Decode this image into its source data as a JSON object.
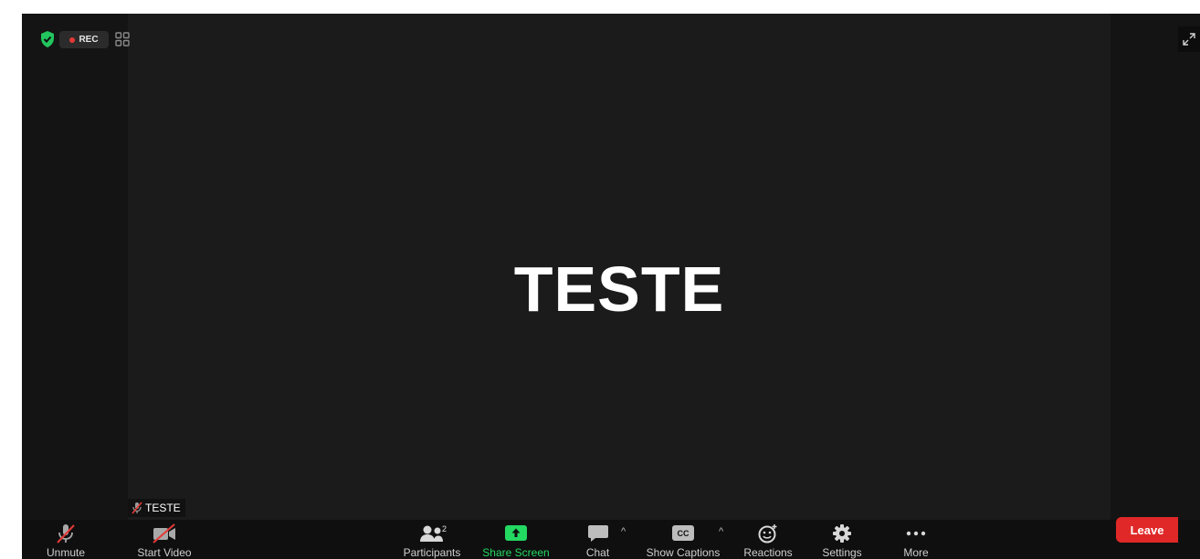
{
  "meeting": {
    "center_name": "TESTE",
    "name_tag": "TESTE",
    "rec_label": "REC"
  },
  "toolbar": {
    "unmute": "Unmute",
    "start_video": "Start Video",
    "participants": "Participants",
    "participants_count": "2",
    "share_screen": "Share Screen",
    "chat": "Chat",
    "show_captions": "Show Captions",
    "captions_icon_text": "CC",
    "reactions": "Reactions",
    "settings": "Settings",
    "more": "More",
    "leave": "Leave"
  },
  "colors": {
    "share_green": "#23d962",
    "leave_red": "#e02828",
    "rec_red": "#e53935",
    "shield_green": "#22c55e",
    "muted_red": "#e53935"
  },
  "icons": [
    "shield-icon",
    "record-dot-icon",
    "grid-view-icon",
    "fullscreen-icon",
    "mic-off-icon",
    "video-off-icon",
    "participants-icon",
    "share-screen-icon",
    "chat-icon",
    "captions-icon",
    "reactions-icon",
    "settings-icon",
    "more-icon",
    "chevron-up-icon"
  ]
}
